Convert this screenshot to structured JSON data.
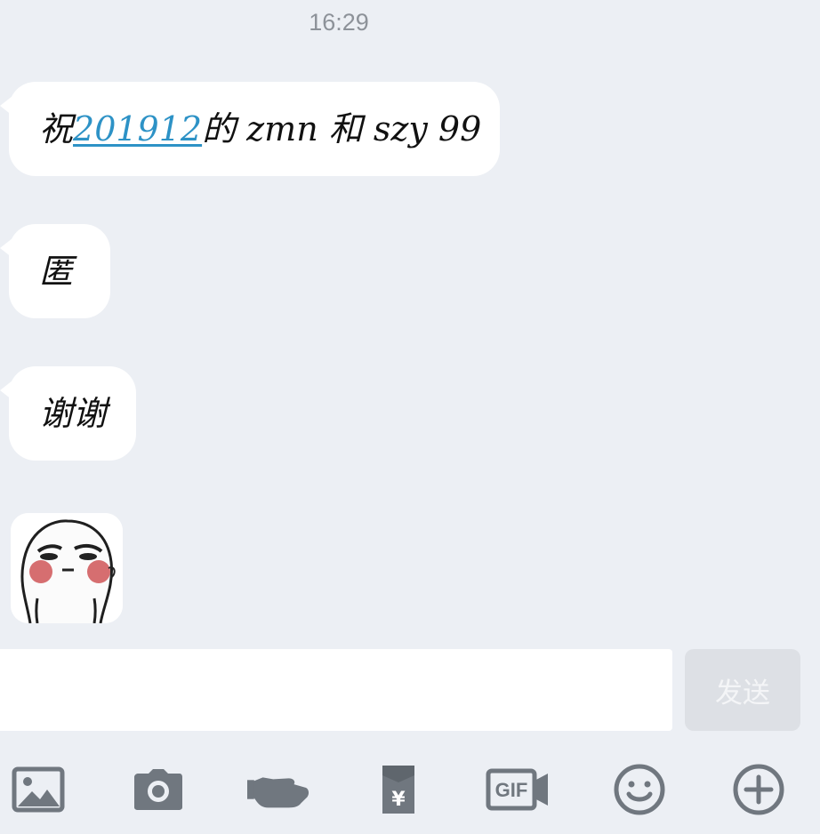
{
  "header": {
    "time": "16:29"
  },
  "messages": [
    {
      "parts": [
        {
          "text": "祝",
          "link": false
        },
        {
          "text": "201912",
          "link": true
        },
        {
          "text": "的 zmn 和 szy 99",
          "link": false
        }
      ]
    },
    {
      "parts": [
        {
          "text": "匿",
          "link": false
        }
      ]
    },
    {
      "parts": [
        {
          "text": "谢谢",
          "link": false
        }
      ]
    },
    {
      "sticker": "smiling-blushing-face-sticker"
    }
  ],
  "composer": {
    "input_value": "",
    "send_label": "发送"
  },
  "toolbar": {
    "icons": [
      "image-icon",
      "camera-icon",
      "poke-hand-icon",
      "red-packet-icon",
      "gif-camera-icon",
      "emoji-icon",
      "plus-icon"
    ],
    "gif_label": "GIF",
    "red_packet_symbol": "¥"
  },
  "colors": {
    "background": "#eceff4",
    "bubble": "#ffffff",
    "link": "#2d92c6",
    "icon": "#70777f",
    "send_disabled": "#dde0e5"
  }
}
